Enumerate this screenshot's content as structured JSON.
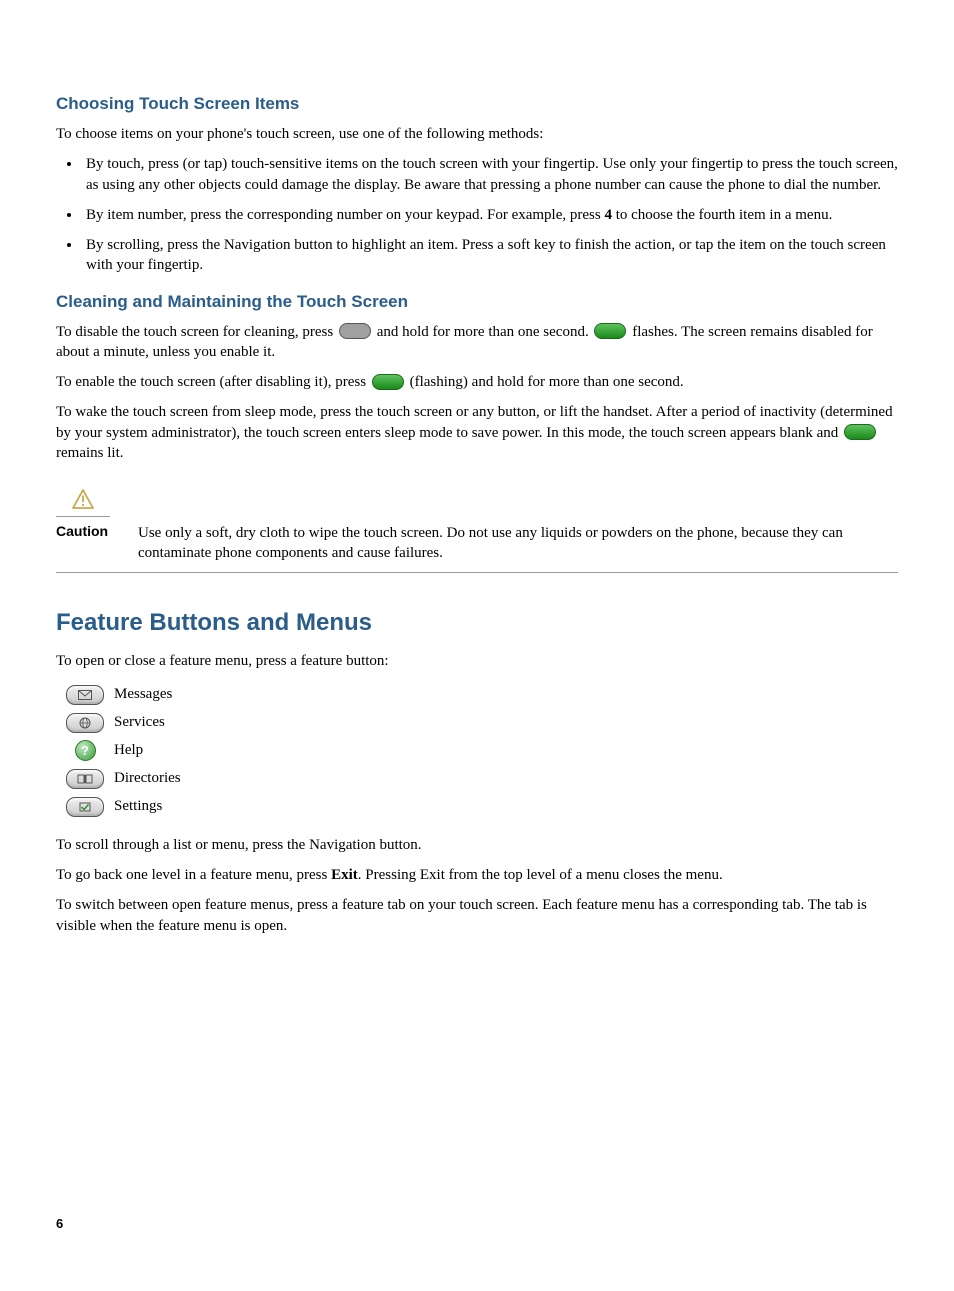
{
  "s1": {
    "title": "Choosing Touch Screen Items",
    "intro": "To choose items on your phone's touch screen, use one of the following methods:",
    "bullets": [
      "By touch, press (or tap) touch-sensitive items on the touch screen with your fingertip. Use only your fingertip to press the touch screen, as using any other objects could damage the display. Be aware that pressing a phone number can cause the phone to dial the number.",
      "By item number, press the corresponding number on your keypad. For example, press 4 to choose the fourth item in a menu.",
      "By scrolling, press the Navigation button to highlight an item. Press a soft key to finish the action, or tap the item on the touch screen with your fingertip."
    ],
    "bullet2_pre": "By item number, press the corresponding number on your keypad. For example, press ",
    "bullet2_bold": "4",
    "bullet2_post": " to choose the fourth item in a menu."
  },
  "s2": {
    "title": "Cleaning and Maintaining the Touch Screen",
    "p1_pre": "To disable the touch screen for cleaning, press ",
    "p1_mid": " and hold for more than one second. ",
    "p1_post": " flashes. The screen remains disabled for about a minute, unless you enable it.",
    "p2_pre": "To enable the touch screen (after disabling it), press ",
    "p2_post": " (flashing) and hold for more than one second.",
    "p3_pre": "To wake the touch screen from sleep mode, press the touch screen or any button, or lift the handset. After a period of inactivity (determined by your system administrator), the touch screen enters sleep mode to save power. In this mode, the touch screen appears blank and ",
    "p3_post": " remains lit."
  },
  "caution": {
    "label": "Caution",
    "text": "Use only a soft, dry cloth to wipe the touch screen. Do not use any liquids or powders on the phone, because they can contaminate phone components and cause failures."
  },
  "s3": {
    "title": "Feature Buttons and Menus",
    "intro": "To open or close a feature menu, press a feature button:",
    "buttons": [
      {
        "label": "Messages"
      },
      {
        "label": "Services"
      },
      {
        "label": "Help"
      },
      {
        "label": "Directories"
      },
      {
        "label": "Settings"
      }
    ],
    "p_scroll": "To scroll through a list or menu, press the Navigation button.",
    "p_back_pre": "To go back one level in a feature menu, press ",
    "p_back_bold": "Exit",
    "p_back_post": ". Pressing Exit from the top level of a menu closes the menu.",
    "p_switch": "To switch between open feature menus, press a feature tab on your touch screen. Each feature menu has a corresponding tab. The tab is visible when the feature menu is open."
  },
  "page_number": "6"
}
